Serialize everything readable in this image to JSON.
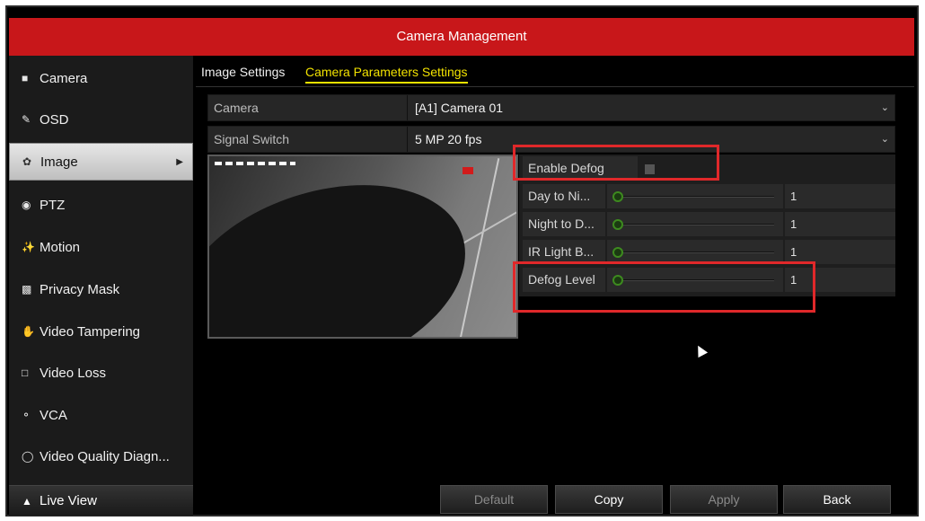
{
  "window": {
    "title": "Camera Management"
  },
  "sidebar": {
    "items": [
      {
        "label": "Camera",
        "icon": "camera-icon"
      },
      {
        "label": "OSD",
        "icon": "osd-icon"
      },
      {
        "label": "Image",
        "icon": "image-icon",
        "active": true
      },
      {
        "label": "PTZ",
        "icon": "ptz-icon"
      },
      {
        "label": "Motion",
        "icon": "motion-icon"
      },
      {
        "label": "Privacy Mask",
        "icon": "privacy-mask-icon"
      },
      {
        "label": "Video Tampering",
        "icon": "hand-icon"
      },
      {
        "label": "Video Loss",
        "icon": "video-loss-icon"
      },
      {
        "label": "VCA",
        "icon": "vca-icon"
      },
      {
        "label": "Video Quality Diagn...",
        "icon": "quality-icon"
      }
    ],
    "live_view": "Live View"
  },
  "tabs": [
    {
      "label": "Image Settings"
    },
    {
      "label": "Camera Parameters Settings",
      "active": true
    }
  ],
  "form": {
    "camera": {
      "label": "Camera",
      "value": "[A1] Camera 01"
    },
    "signal": {
      "label": "Signal Switch",
      "value": "5 MP 20 fps"
    }
  },
  "defog": {
    "enable_label": "Enable Defog",
    "enabled": false,
    "sliders": [
      {
        "label": "Day to Ni...",
        "value": "1"
      },
      {
        "label": "Night to D...",
        "value": "1"
      },
      {
        "label": "IR Light B...",
        "value": "1"
      },
      {
        "label": "Defog Level",
        "value": "1"
      }
    ]
  },
  "buttons": {
    "default": "Default",
    "copy": "Copy",
    "apply": "Apply",
    "back": "Back"
  },
  "colors": {
    "title_bar": "#c8171a",
    "active_tab": "#f2e200",
    "highlight": "#e0282a",
    "slider_knob": "#3d8a1f"
  }
}
